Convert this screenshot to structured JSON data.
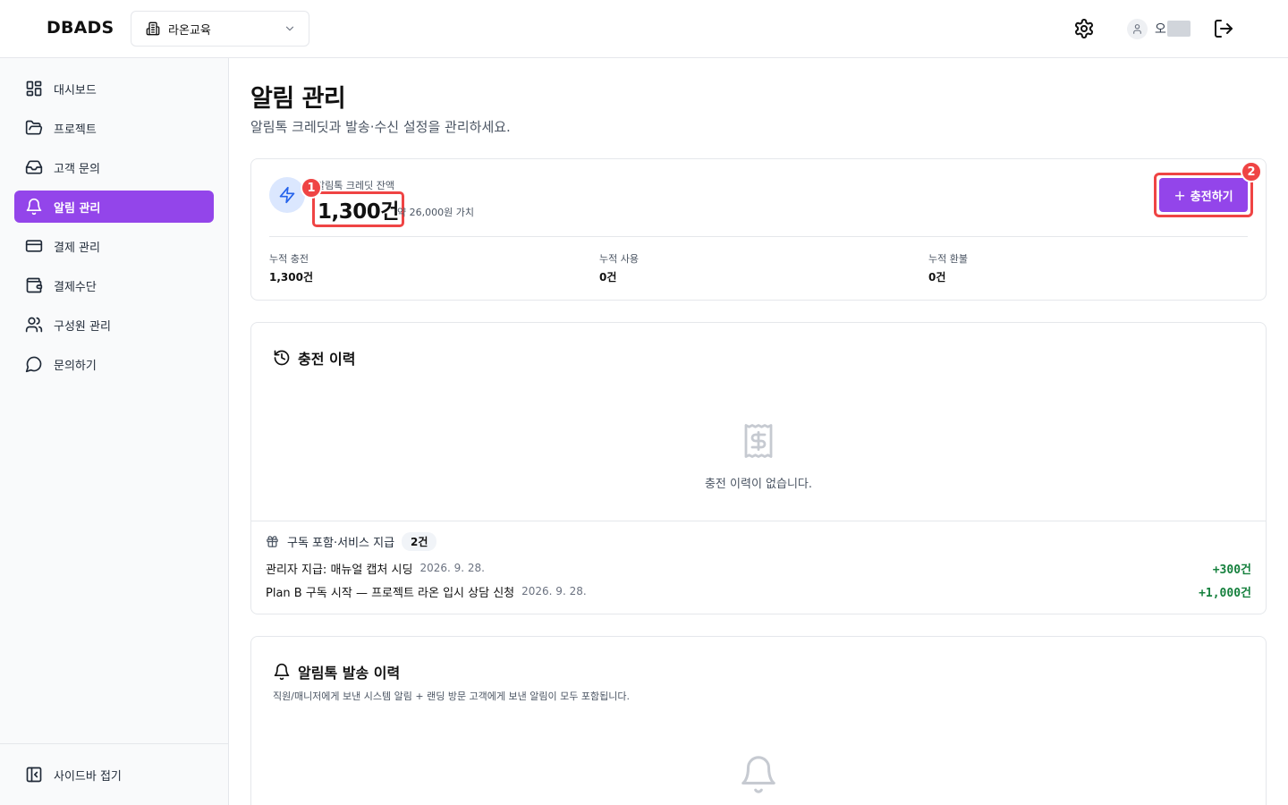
{
  "header": {
    "logo": "DBADS",
    "org_name": "라온교육",
    "user_name": "오"
  },
  "sidebar": {
    "items": [
      {
        "label": "대시보드",
        "icon": "dashboard-grid-icon",
        "active": false
      },
      {
        "label": "프로젝트",
        "icon": "folder-open-icon",
        "active": false
      },
      {
        "label": "고객 문의",
        "icon": "inbox-icon",
        "active": false
      },
      {
        "label": "알림 관리",
        "icon": "bell-icon",
        "active": true
      },
      {
        "label": "결제 관리",
        "icon": "credit-card-icon",
        "active": false
      },
      {
        "label": "결제수단",
        "icon": "wallet-icon",
        "active": false
      },
      {
        "label": "구성원 관리",
        "icon": "users-icon",
        "active": false
      },
      {
        "label": "문의하기",
        "icon": "message-circle-icon",
        "active": false
      }
    ],
    "collapse_label": "사이드바 접기"
  },
  "page": {
    "title": "알림 관리",
    "subtitle": "알림톡 크레딧과 발송·수신 설정을 관리하세요."
  },
  "credit": {
    "label": "알림톡 크레딧 잔액",
    "value": "1,300건",
    "worth": "약 26,000원 가치",
    "charge_label": "충전하기",
    "stats": [
      {
        "label": "누적 충전",
        "value": "1,300건"
      },
      {
        "label": "누적 사용",
        "value": "0건"
      },
      {
        "label": "누적 환불",
        "value": "0건"
      }
    ]
  },
  "markers": {
    "one": "1",
    "two": "2"
  },
  "history": {
    "title": "충전 이력",
    "empty_text": "충전 이력이 없습니다.",
    "grant_title": "구독 포함·서비스 지급",
    "grant_count": "2건",
    "grants": [
      {
        "desc": "관리자 지급: 매뉴얼 캡처 시딩",
        "date": "2026. 9. 28.",
        "amount": "+300건"
      },
      {
        "desc": "Plan B 구독 시작 — 프로젝트 라온 입시 상담 신청",
        "date": "2026. 9. 28.",
        "amount": "+1,000건"
      }
    ]
  },
  "sendlog": {
    "title": "알림톡 발송 이력",
    "description": "직원/매니저에게 보낸 시스템 알림 + 랜딩 방문 고객에게 보낸 알림이 모두 포함됩니다."
  },
  "colors": {
    "accent": "#9345ea",
    "marker": "#ef4444",
    "positive": "#15803d"
  }
}
